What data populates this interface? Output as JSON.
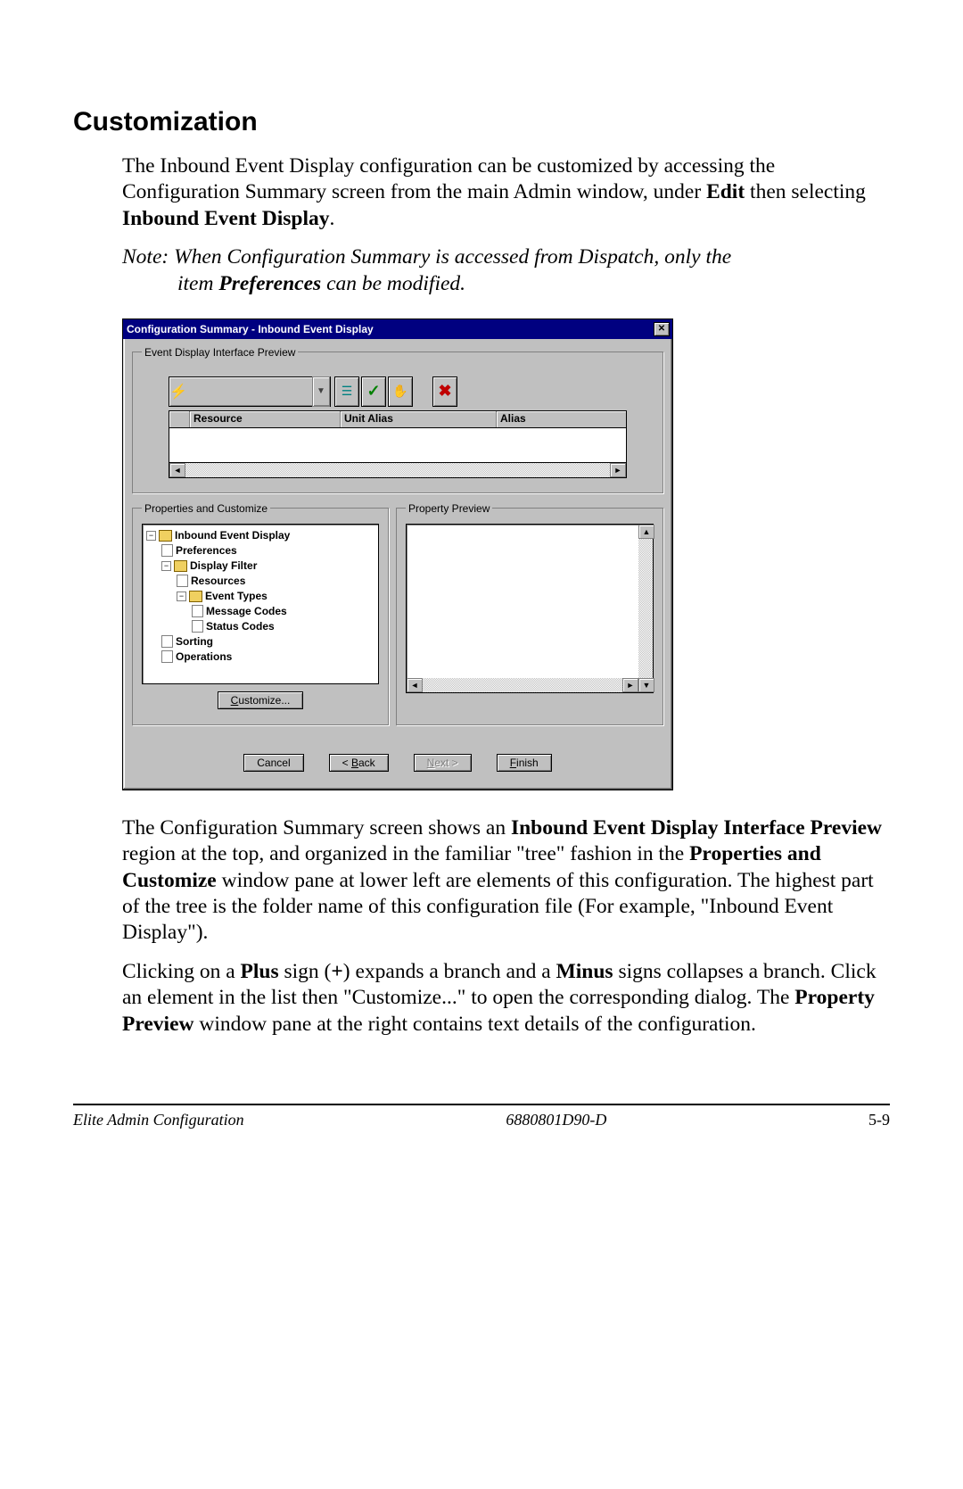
{
  "section_title": "Customization",
  "para1_a": "The Inbound Event Display configuration can be customized by accessing the Configuration Summary screen from the main Admin window, under ",
  "para1_b": "Edit",
  "para1_c": " then selecting ",
  "para1_d": "Inbound Event Display",
  "para1_e": ".",
  "note_a": "Note:  When Configuration Summary is accessed from Dispatch, only the ",
  "note_b": "item ",
  "note_c": "Preferences",
  "note_d": " can be modified.",
  "dialog": {
    "title": "Configuration Summary - Inbound Event  Display",
    "preview_legend": "Event Display Interface Preview",
    "columns": {
      "c1": "Resource",
      "c2": "Unit Alias",
      "c3": "Alias"
    },
    "props_legend": "Properties and Customize",
    "proppreview_legend": "Property Preview",
    "tree": {
      "root": "Inbound Event  Display",
      "preferences": "Preferences",
      "display_filter": "Display Filter",
      "resources": "Resources",
      "event_types": "Event Types",
      "message_codes": "Message Codes",
      "status_codes": "Status Codes",
      "sorting": "Sorting",
      "operations": "Operations"
    },
    "customize_btn_pre": "C",
    "customize_btn_mid": "ustomize...",
    "buttons": {
      "cancel": "Cancel",
      "back_u": "B",
      "back_rest": "ack",
      "back_pre": "< ",
      "next_u": "N",
      "next_rest": "ext >",
      "finish_u": "F",
      "finish_rest": "inish"
    }
  },
  "para2_a": "The Configuration Summary screen shows an ",
  "para2_b": "Inbound Event Display Interface Preview",
  "para2_c": " region at the top, and organized in the familiar \"tree\" fashion in the ",
  "para2_d": "Properties and Customize",
  "para2_e": " window pane at lower left are elements of this configuration.  The highest part of the tree is the folder name of this configuration file (For example, \"Inbound Event Display\").",
  "para3_a": "Clicking on a ",
  "para3_b": "Plus",
  "para3_c": " sign (",
  "para3_d": "+",
  "para3_e": ") expands a branch and a ",
  "para3_f": "Minus",
  "para3_g": " signs collapses a branch.  Click an element in the list then \"Customize...\" to open the corresponding dialog.  The ",
  "para3_h": "Property Preview",
  "para3_i": " window pane at the right contains text details of the configuration.",
  "footer": {
    "left": "Elite Admin Configuration",
    "mid": "6880801D90-D",
    "right": "5-9"
  }
}
